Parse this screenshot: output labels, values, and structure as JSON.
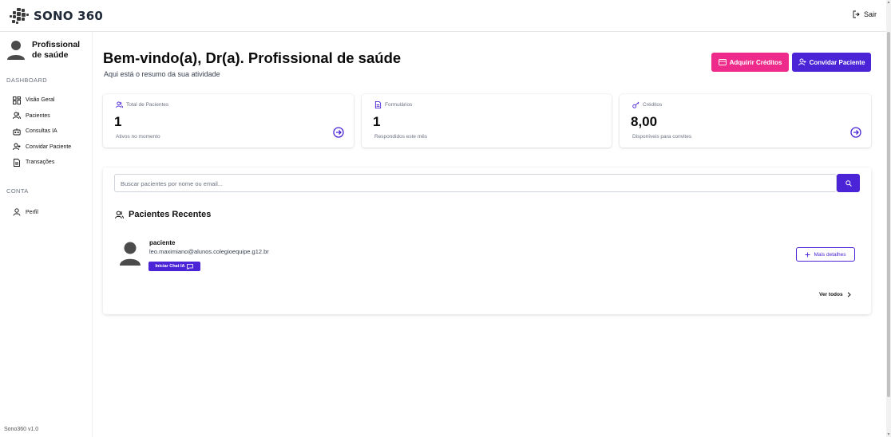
{
  "app": {
    "name": "SONO 360",
    "logout_label": "Sair",
    "version": "Sono360 v1.0"
  },
  "sidebar": {
    "user_name": "Profissional de saúde",
    "sections": [
      {
        "title": "DASHBOARD",
        "items": [
          {
            "label": "Visão Geral",
            "icon": "grid-icon"
          },
          {
            "label": "Pacientes",
            "icon": "users-icon"
          },
          {
            "label": "Consultas IA",
            "icon": "bot-icon"
          },
          {
            "label": "Convidar Paciente",
            "icon": "user-plus-icon"
          },
          {
            "label": "Transações",
            "icon": "document-icon"
          }
        ]
      },
      {
        "title": "CONTA",
        "items": [
          {
            "label": "Perfil",
            "icon": "user-icon"
          }
        ]
      }
    ]
  },
  "header": {
    "title": "Bem-vindo(a), Dr(a). Profissional de saúde",
    "subtitle": "Aqui está o resumo da sua atividade",
    "buy_credits_label": "Adquirir Créditos",
    "invite_patient_label": "Convidar Paciente"
  },
  "stats": [
    {
      "title": "Total de Pacientes",
      "value": "1",
      "footer": "Ativos no momento",
      "icon": "users-icon",
      "has_link": true
    },
    {
      "title": "Formulários",
      "value": "1",
      "footer": "Respondidos este mês",
      "icon": "document-icon",
      "has_link": false
    },
    {
      "title": "Créditos",
      "value": "8,00",
      "footer": "Disponíveis para convites",
      "icon": "key-icon",
      "has_link": true
    }
  ],
  "search": {
    "placeholder": "Buscar pacientes por nome ou email..."
  },
  "recent": {
    "title": "Pacientes Recentes",
    "patients": [
      {
        "name": "paciente",
        "email": "leo.maximiano@alunos.colegioequipe.g12.br",
        "chat_label": "Iniciar Chat IA",
        "details_label": "Mais detalhes"
      }
    ],
    "see_all_label": "Ver todos"
  },
  "colors": {
    "accent": "#4a24d6",
    "pink": "#ee2b8b"
  }
}
